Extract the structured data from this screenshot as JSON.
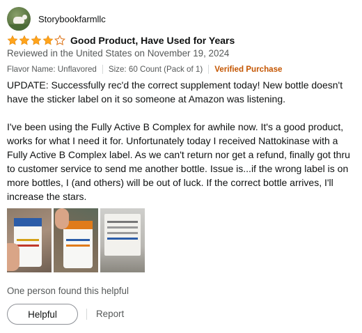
{
  "profile": {
    "name": "Storybookfarmllc",
    "avatar_icon": "farm-animal-avatar"
  },
  "rating": {
    "value": 4,
    "max": 5,
    "star_color": "#ffa41c",
    "empty_star_color": "#de7921"
  },
  "review": {
    "title": "Good Product, Have Used for Years",
    "date": "Reviewed in the United States on November 19, 2024",
    "format": {
      "flavor": "Flavor Name: Unflavored",
      "size": "Size: 60 Count (Pack of 1)",
      "verified": "Verified Purchase"
    },
    "body": "UPDATE: Successfully rec'd the correct supplement today! New bottle doesn't have the sticker label on it so someone at Amazon was listening.\n\nI've been using the Fully Active B Complex for awhile now. It's a good product, works for what I need it for. Unfortunately today I received Nattokinase with a Fully Active B Complex label. As we can't return nor get a refund, finally got thru to customer service to send me another bottle. Issue is...if the wrong label is on more bottles, I (and others) will be out of luck. If the correct bottle arrives, I'll increase the stars.",
    "images": [
      {
        "icon": "supplement-bottle-photo"
      },
      {
        "icon": "supplement-bottle-photo"
      },
      {
        "icon": "bottle-label-photo"
      }
    ]
  },
  "feedback": {
    "helpful_count_text": "One person found this helpful",
    "helpful_button": "Helpful",
    "report_link": "Report"
  }
}
